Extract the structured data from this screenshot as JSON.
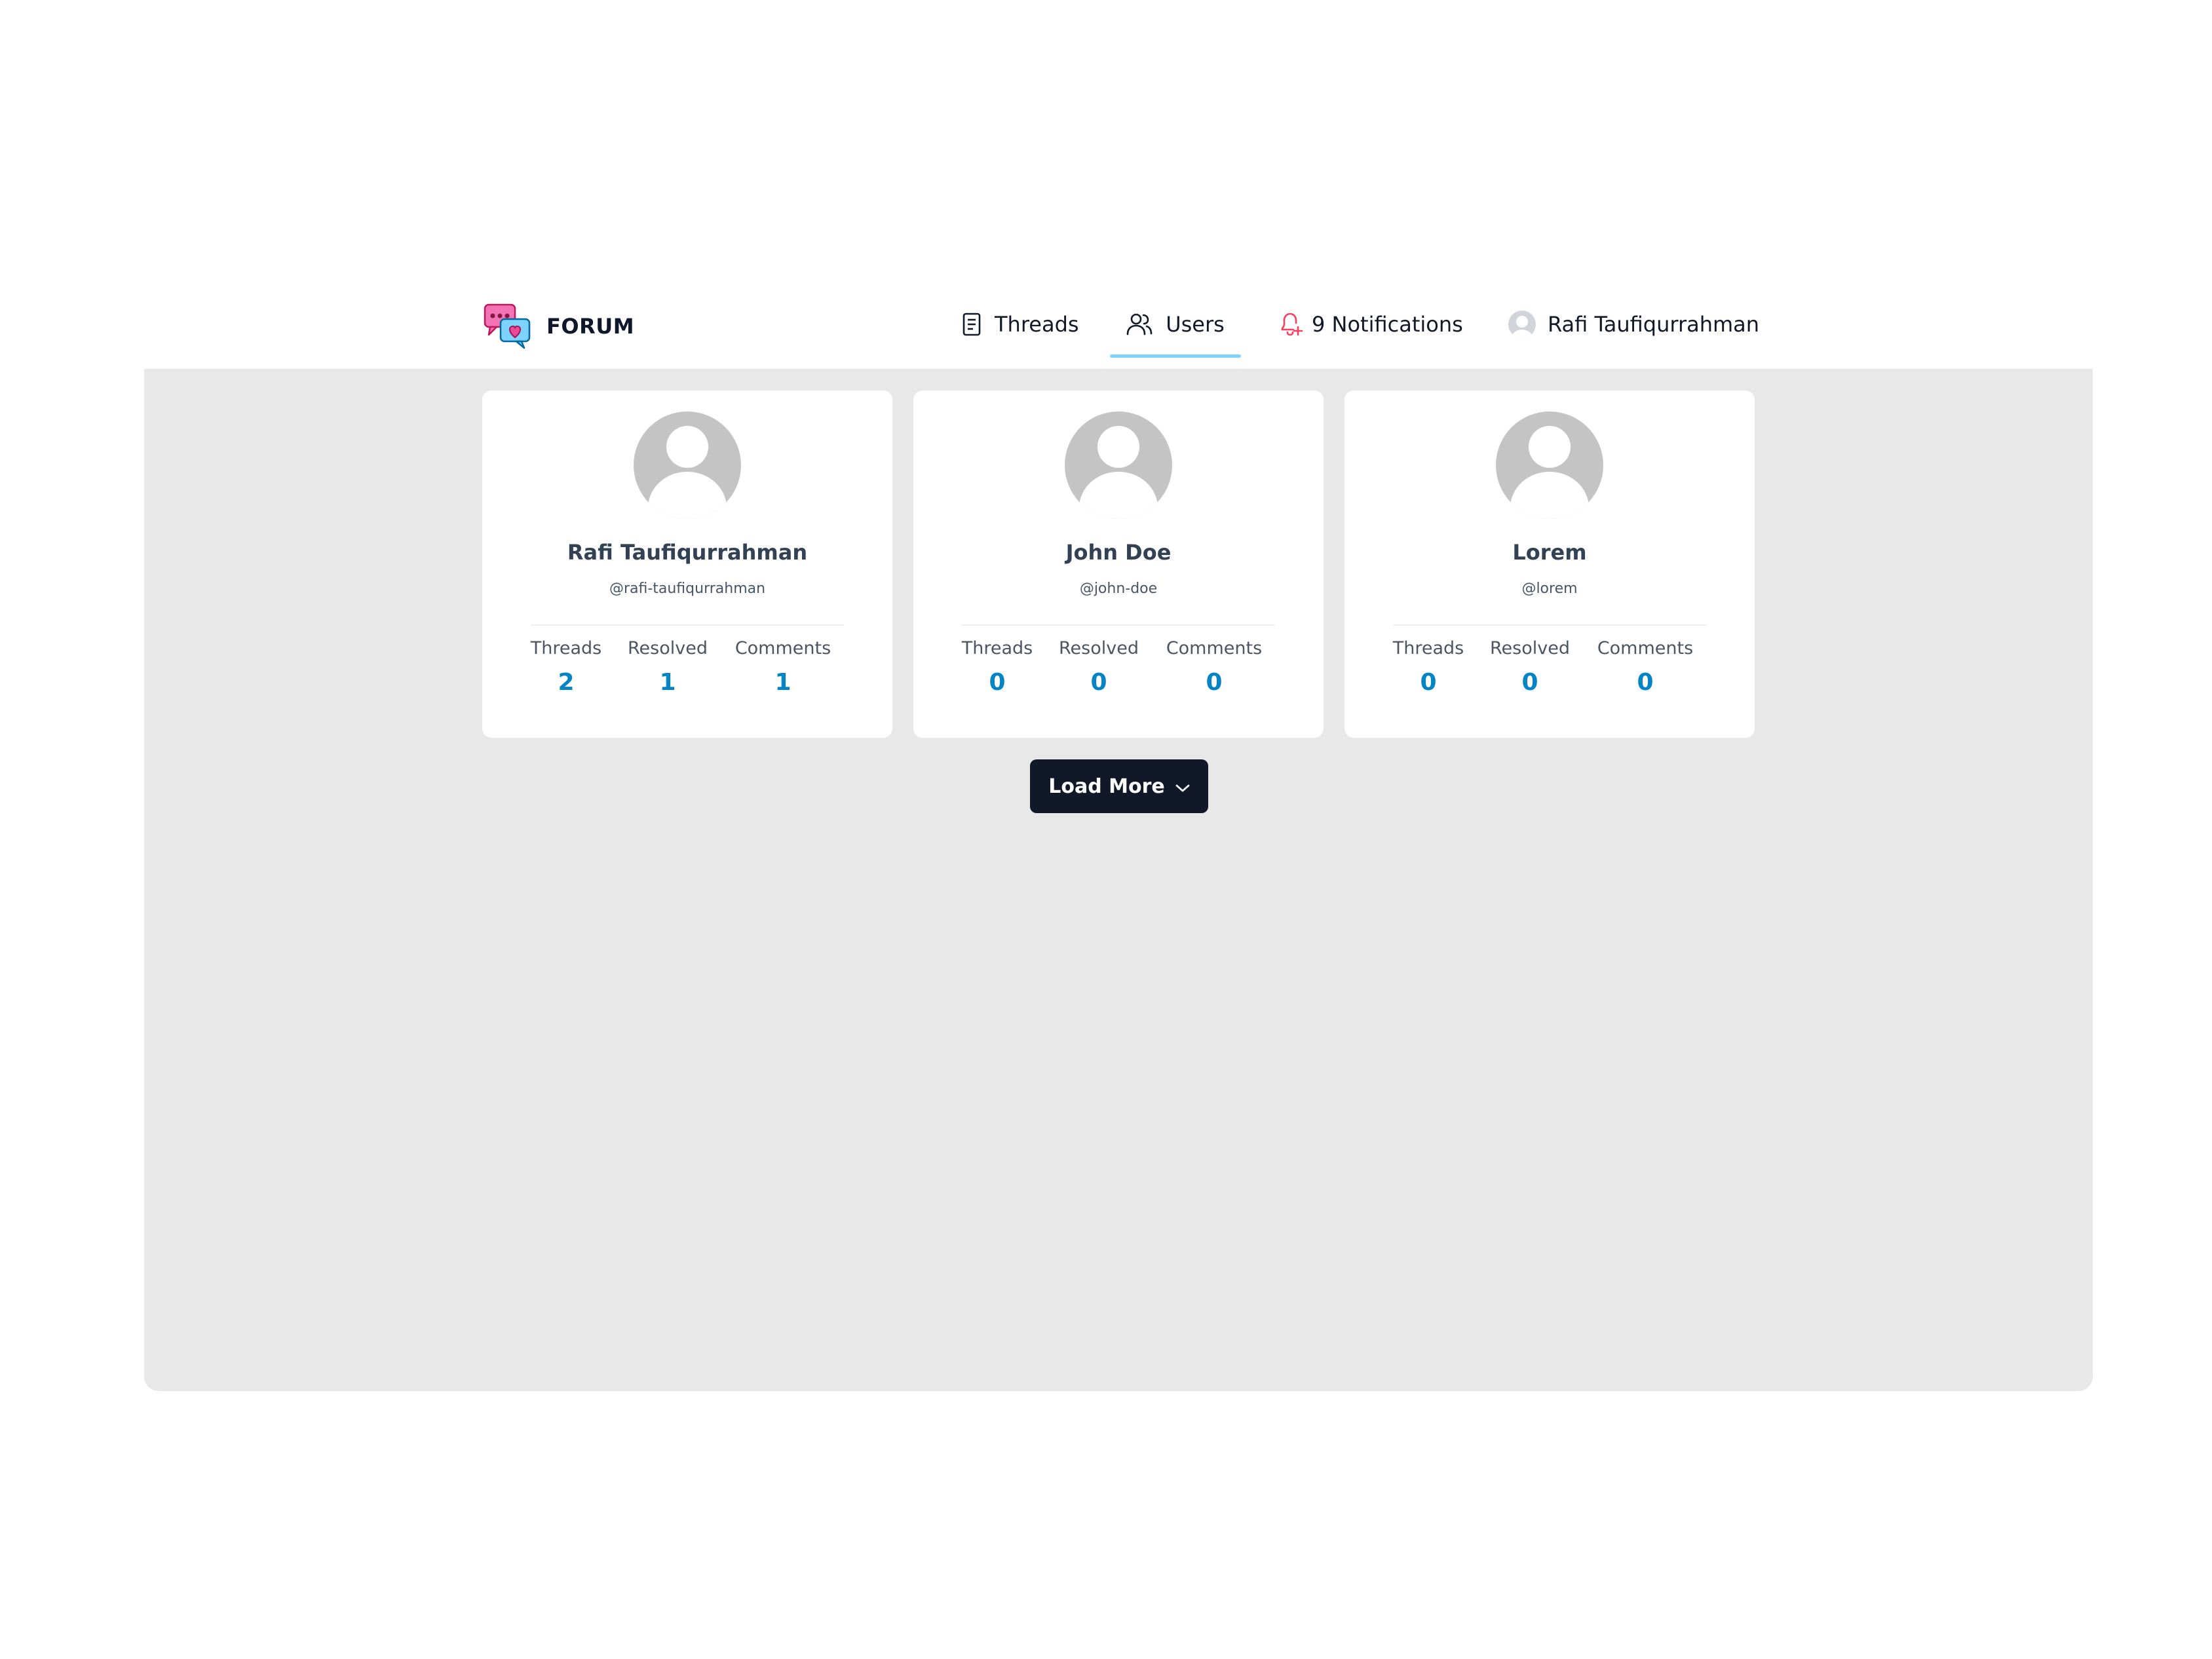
{
  "brand": {
    "name": "FORUM",
    "logo_icon": "forum-chat-heart-logo"
  },
  "nav": {
    "threads": {
      "label": "Threads",
      "icon": "document-icon"
    },
    "users": {
      "label": "Users",
      "icon": "users-icon",
      "active": true
    },
    "notifications": {
      "label": "9 Notifications",
      "icon": "bell-icon",
      "color": "#f43f5e"
    },
    "account": {
      "label": "Rafi Taufiqurrahman",
      "icon": "avatar"
    }
  },
  "users": [
    {
      "name": "Rafi Taufiqurrahman",
      "username": "@rafi-taufiqurrahman",
      "threads_label": "Threads",
      "threads": "2",
      "resolved_label": "Resolved",
      "resolved": "1",
      "comments_label": "Comments",
      "comments": "1"
    },
    {
      "name": "John Doe",
      "username": "@john-doe",
      "threads_label": "Threads",
      "threads": "0",
      "resolved_label": "Resolved",
      "resolved": "0",
      "comments_label": "Comments",
      "comments": "0"
    },
    {
      "name": "Lorem",
      "username": "@lorem",
      "threads_label": "Threads",
      "threads": "0",
      "resolved_label": "Resolved",
      "resolved": "0",
      "comments_label": "Comments",
      "comments": "0"
    }
  ],
  "load_more": {
    "label": "Load More",
    "icon": "chevron-down-icon"
  },
  "colors": {
    "accent": "#0284c7",
    "active_tab_underline": "#7dd3fc",
    "button_bg": "#111827",
    "page_bg": "#e8e8e8"
  }
}
